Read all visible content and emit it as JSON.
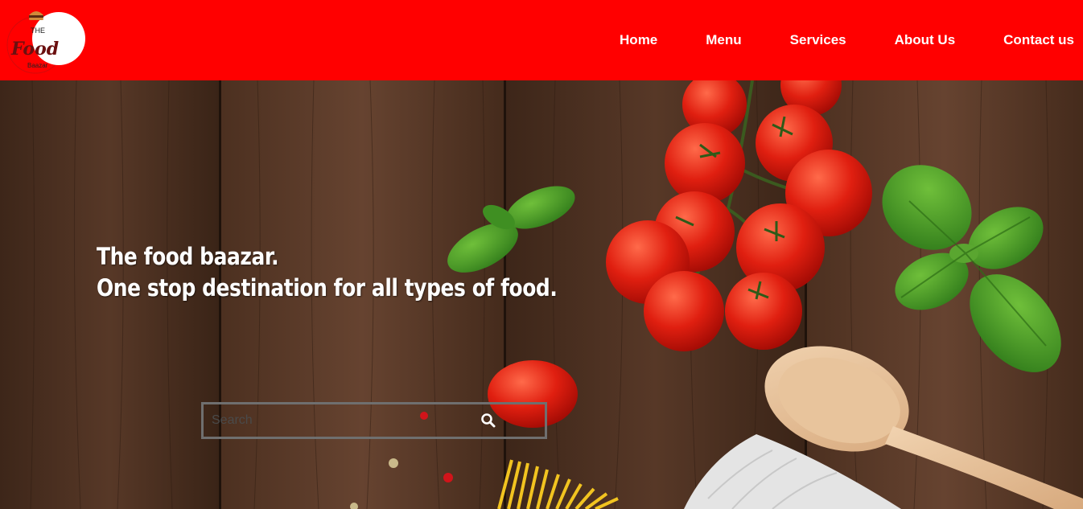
{
  "header": {
    "logo": {
      "top_text": "THE",
      "main_text": "Food",
      "bottom_text": "Baazar"
    },
    "nav": [
      {
        "label": "Home"
      },
      {
        "label": "Menu"
      },
      {
        "label": "Services"
      },
      {
        "label": "About Us"
      },
      {
        "label": "Contact us"
      }
    ],
    "background_color": "#ff0000"
  },
  "hero": {
    "headline_line1": "The food baazar.",
    "headline_line2": "One stop destination for all types of food."
  },
  "search": {
    "placeholder": "Search",
    "value": ""
  },
  "icons": {
    "search": "magnifier-icon"
  }
}
